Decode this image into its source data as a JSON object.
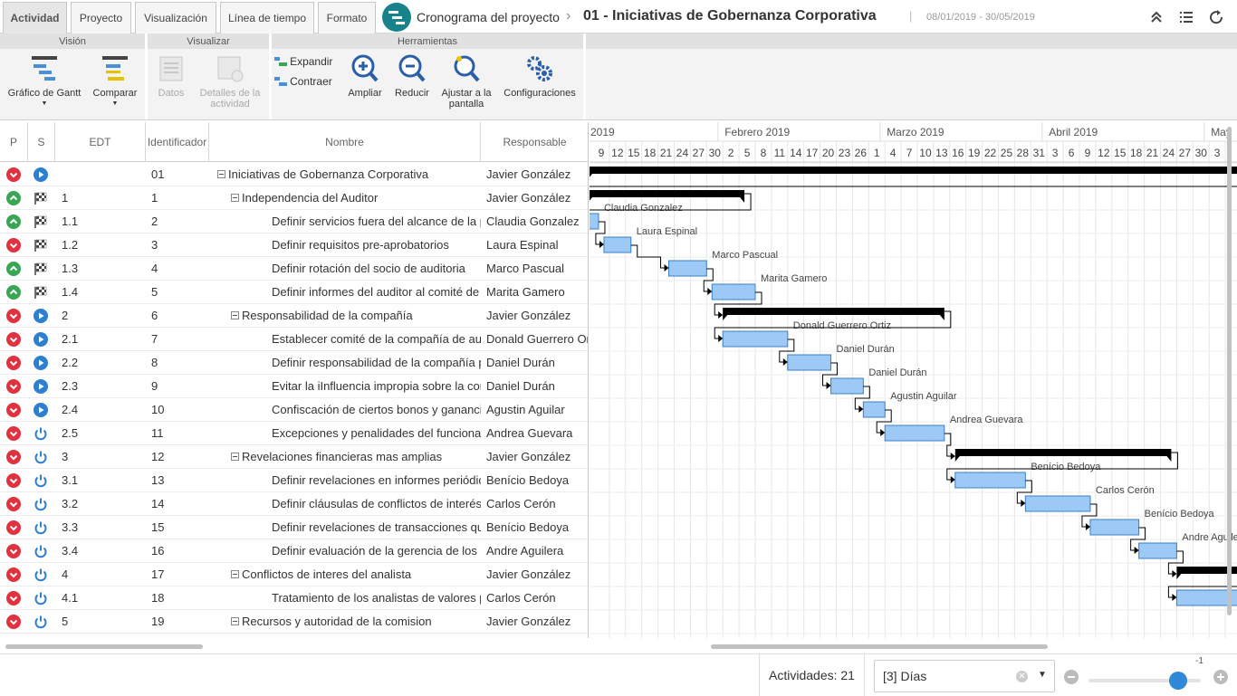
{
  "tabs": [
    {
      "label": "Actividad",
      "active": true
    },
    {
      "label": "Proyecto",
      "active": false
    },
    {
      "label": "Visualización",
      "active": false
    },
    {
      "label": "Línea de tiempo",
      "active": false
    },
    {
      "label": "Formato",
      "active": false
    }
  ],
  "header": {
    "project_label": "Cronograma del proyecto",
    "separator": "›",
    "title": "01 - Iniciativas de Gobernanza Corporativa",
    "bar": "|",
    "dates": "08/01/2019 - 30/05/2019"
  },
  "ribbon": {
    "groups": {
      "vision": "Visión",
      "visualizar": "Visualizar",
      "herramientas": "Herramientas"
    },
    "gantt": "Gráfico de Gantt",
    "comparar": "Comparar",
    "datos": "Datos",
    "detalles": "Detalles de la actividad",
    "expandir": "Expandir",
    "contraer": "Contraer",
    "ampliar": "Ampliar",
    "reducir": "Reducir",
    "ajustar": "Ajustar a la pantalla",
    "config": "Configuraciones"
  },
  "columns": {
    "p": "P",
    "s": "S",
    "edt": "EDT",
    "id": "Identificador",
    "nombre": "Nombre",
    "responsable": "Responsable"
  },
  "rows": [
    {
      "p": "red",
      "s": "play",
      "edt": "",
      "id": "01",
      "name": "Iniciativas de Gobernanza Corporativa",
      "resp": "Javier González",
      "level": 0,
      "group": true
    },
    {
      "p": "green",
      "s": "flag",
      "edt": "1",
      "id": "1",
      "name": "Independencia del Auditor",
      "resp": "Javier González",
      "level": 1,
      "group": true
    },
    {
      "p": "green",
      "s": "flag",
      "edt": "1.1",
      "id": "2",
      "name": "Definir servicios fuera del alcance de la práctica",
      "resp": "Claudia Gonzalez",
      "level": 2,
      "group": false
    },
    {
      "p": "red",
      "s": "flag",
      "edt": "1.2",
      "id": "3",
      "name": "Definir requisitos pre-aprobatorios",
      "resp": "Laura Espinal",
      "level": 2,
      "group": false
    },
    {
      "p": "green",
      "s": "flag",
      "edt": "1.3",
      "id": "4",
      "name": "Definir rotación del socio de auditoria",
      "resp": "Marco Pascual",
      "level": 2,
      "group": false
    },
    {
      "p": "green",
      "s": "flag",
      "edt": "1.4",
      "id": "5",
      "name": "Definir informes del auditor al comité de auditoría",
      "resp": "Marita Gamero",
      "level": 2,
      "group": false
    },
    {
      "p": "red",
      "s": "play",
      "edt": "2",
      "id": "6",
      "name": "Responsabilidad de la compañía",
      "resp": "Javier González",
      "level": 1,
      "group": true
    },
    {
      "p": "red",
      "s": "play",
      "edt": "2.1",
      "id": "7",
      "name": "Establecer comité de la compañía de auditoría",
      "resp": "Donald Guerrero Ortiz",
      "level": 2,
      "group": false
    },
    {
      "p": "red",
      "s": "play",
      "edt": "2.2",
      "id": "8",
      "name": "Definir responsabilidad de la compañía por",
      "resp": "Daniel Durán",
      "level": 2,
      "group": false
    },
    {
      "p": "red",
      "s": "play",
      "edt": "2.3",
      "id": "9",
      "name": "Evitar la iInfluencia impropia sobre la conducta",
      "resp": "Daniel Durán",
      "level": 2,
      "group": false
    },
    {
      "p": "red",
      "s": "play",
      "edt": "2.4",
      "id": "10",
      "name": "Confiscación de ciertos bonos y ganancias",
      "resp": "Agustin Aguilar",
      "level": 2,
      "group": false
    },
    {
      "p": "red",
      "s": "power",
      "edt": "2.5",
      "id": "11",
      "name": "Excepciones y penalidades del funcionario",
      "resp": "Andrea Guevara",
      "level": 2,
      "group": false
    },
    {
      "p": "red",
      "s": "power",
      "edt": "3",
      "id": "12",
      "name": "Revelaciones financieras mas amplias",
      "resp": "Javier González",
      "level": 1,
      "group": true
    },
    {
      "p": "red",
      "s": "power",
      "edt": "3.1",
      "id": "13",
      "name": "Definir revelaciones en informes periódicos",
      "resp": "Benício Bedoya",
      "level": 2,
      "group": false
    },
    {
      "p": "red",
      "s": "power",
      "edt": "3.2",
      "id": "14",
      "name": "Definir cláusulas de conflictos de interés",
      "resp": "Carlos Cerón",
      "level": 2,
      "group": false
    },
    {
      "p": "red",
      "s": "power",
      "edt": "3.3",
      "id": "15",
      "name": "Definir revelaciones de transacciones que",
      "resp": "Benício Bedoya",
      "level": 2,
      "group": false
    },
    {
      "p": "red",
      "s": "power",
      "edt": "3.4",
      "id": "16",
      "name": "Definir evaluación de la gerencia de los controles",
      "resp": "Andre Aguilera",
      "level": 2,
      "group": false
    },
    {
      "p": "red",
      "s": "power",
      "edt": "4",
      "id": "17",
      "name": "Conflictos de interes del analista",
      "resp": "Javier González",
      "level": 1,
      "group": true
    },
    {
      "p": "red",
      "s": "power",
      "edt": "4.1",
      "id": "18",
      "name": "Tratamiento de los analistas de valores para",
      "resp": "Carlos Cerón",
      "level": 2,
      "group": false
    },
    {
      "p": "red",
      "s": "power",
      "edt": "5",
      "id": "19",
      "name": "Recursos y autoridad de la comision",
      "resp": "Javier González",
      "level": 1,
      "group": true
    }
  ],
  "timeline": {
    "months": [
      {
        "label": "2019",
        "first_day_index": 0
      },
      {
        "label": "Febrero 2019",
        "first_day_index": 8
      },
      {
        "label": "Marzo 2019",
        "first_day_index": 18
      },
      {
        "label": "Abril 2019",
        "first_day_index": 28
      },
      {
        "label": "May",
        "first_day_index": 38
      }
    ],
    "days": [
      "9",
      "12",
      "15",
      "18",
      "21",
      "24",
      "27",
      "30",
      "2",
      "5",
      "8",
      "11",
      "14",
      "17",
      "20",
      "23",
      "26",
      "1",
      "4",
      "7",
      "10",
      "13",
      "16",
      "19",
      "22",
      "25",
      "28",
      "31",
      "3",
      "6",
      "9",
      "12",
      "15",
      "18",
      "21",
      "24",
      "27",
      "30",
      "3"
    ],
    "tasks": [
      {
        "row": 0,
        "type": "summary",
        "start": "2019-01-08",
        "end": "2019-05-30"
      },
      {
        "row": 1,
        "type": "summary",
        "start": "2019-01-08",
        "end": "2019-02-06"
      },
      {
        "row": 2,
        "type": "task",
        "start": "2019-01-08",
        "end": "2019-01-10",
        "label": "Claudia Gonzalez"
      },
      {
        "row": 3,
        "type": "task",
        "start": "2019-01-11",
        "end": "2019-01-16",
        "label": "Laura Espinal"
      },
      {
        "row": 4,
        "type": "task",
        "start": "2019-01-23",
        "end": "2019-01-30",
        "label": "Marco Pascual"
      },
      {
        "row": 5,
        "type": "task",
        "start": "2019-01-31",
        "end": "2019-02-08",
        "label": "Marita Gamero"
      },
      {
        "row": 6,
        "type": "summary",
        "start": "2019-02-02",
        "end": "2019-03-15"
      },
      {
        "row": 7,
        "type": "task",
        "start": "2019-02-02",
        "end": "2019-02-14",
        "label": "Donald Guerrero Ortiz"
      },
      {
        "row": 8,
        "type": "task",
        "start": "2019-02-14",
        "end": "2019-02-22",
        "label": "Daniel Durán"
      },
      {
        "row": 9,
        "type": "task",
        "start": "2019-02-22",
        "end": "2019-02-28",
        "label": "Daniel Durán"
      },
      {
        "row": 10,
        "type": "task",
        "start": "2019-02-28",
        "end": "2019-03-04",
        "label": "Agustin Aguilar"
      },
      {
        "row": 11,
        "type": "task",
        "start": "2019-03-04",
        "end": "2019-03-15",
        "label": "Andrea Guevara"
      },
      {
        "row": 12,
        "type": "summary",
        "start": "2019-03-17",
        "end": "2019-04-26"
      },
      {
        "row": 13,
        "type": "task",
        "start": "2019-03-17",
        "end": "2019-03-30",
        "label": "Benício Bedoya"
      },
      {
        "row": 14,
        "type": "task",
        "start": "2019-03-30",
        "end": "2019-04-11",
        "label": "Carlos Cerón"
      },
      {
        "row": 15,
        "type": "task",
        "start": "2019-04-11",
        "end": "2019-04-20",
        "label": "Benício Bedoya"
      },
      {
        "row": 16,
        "type": "task",
        "start": "2019-04-20",
        "end": "2019-04-27",
        "label": "Andre Aguilera"
      },
      {
        "row": 17,
        "type": "summary",
        "start": "2019-04-27",
        "end": "2019-05-30"
      },
      {
        "row": 18,
        "type": "task",
        "start": "2019-04-27",
        "end": "2019-05-30",
        "label": ""
      }
    ]
  },
  "status": {
    "activities": "Actividades: 21",
    "zoom_select": "[3] Días",
    "zoom_level": "-1",
    "zoom_fraction": 0.8
  },
  "colors": {
    "accent": "#2f88d8",
    "task_fill": "#9cc9f5",
    "task_border": "#3b7fc4",
    "summary": "#000000",
    "red": "#e0323f",
    "green": "#3aa655",
    "logo": "#17828a"
  }
}
